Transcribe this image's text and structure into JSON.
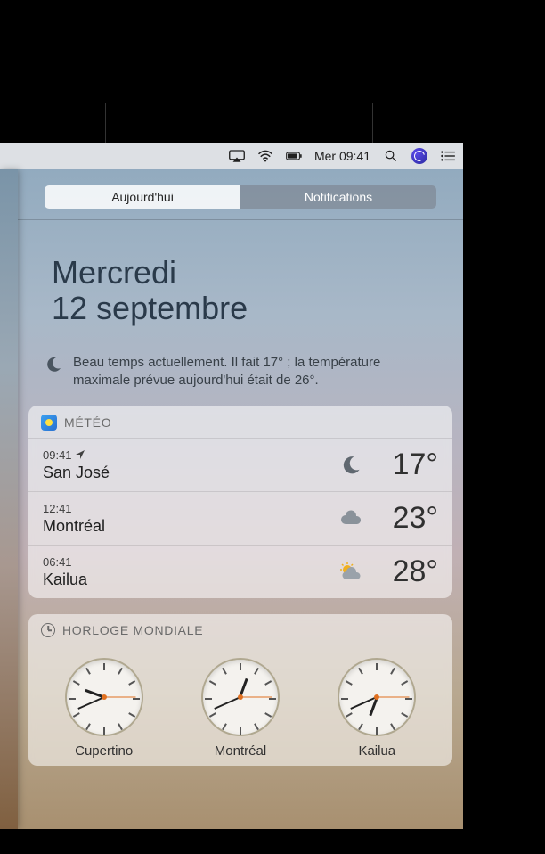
{
  "menubar": {
    "clock_text": "Mer 09:41"
  },
  "tabs": {
    "today": "Aujourd'hui",
    "notifications": "Notifications"
  },
  "date": {
    "weekday": "Mercredi",
    "day_month": "12 septembre"
  },
  "summary": {
    "text": "Beau temps actuellement. Il fait 17° ; la température maximale prévue aujourd'hui était de 26°."
  },
  "weather": {
    "title": "MÉTÉO",
    "rows": [
      {
        "time": "09:41",
        "is_local": true,
        "city": "San José",
        "icon": "moon",
        "temp": "17°"
      },
      {
        "time": "12:41",
        "is_local": false,
        "city": "Montréal",
        "icon": "cloud",
        "temp": "23°"
      },
      {
        "time": "06:41",
        "is_local": false,
        "city": "Kailua",
        "icon": "partly-sunny",
        "temp": "28°"
      }
    ]
  },
  "world_clock": {
    "title": "HORLOGE MONDIALE",
    "clocks": [
      {
        "city": "Cupertino",
        "hour": 9,
        "minute": 41
      },
      {
        "city": "Montréal",
        "hour": 12,
        "minute": 41
      },
      {
        "city": "Kailua",
        "hour": 6,
        "minute": 41
      }
    ]
  }
}
